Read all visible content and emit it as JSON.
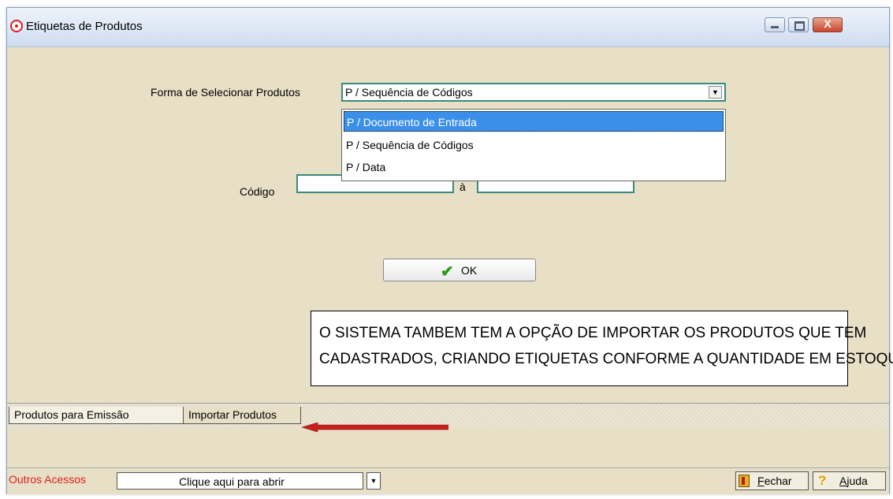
{
  "window": {
    "title": "Etiquetas de Produtos",
    "close_symbol": "X"
  },
  "form": {
    "select_label": "Forma de Selecionar Produtos",
    "select_value": "P / Sequência de Códigos",
    "options": [
      "P / Documento de Entrada",
      "P / Sequência de Códigos",
      "P / Data"
    ],
    "codigo_label": "Código",
    "range_separator": "à",
    "ok_label": "OK"
  },
  "note": {
    "line1": "O SISTEMA TAMBEM TEM A OPÇÃO DE IMPORTAR OS PRODUTOS QUE TEM",
    "line2": "CADASTRADOS,  CRIANDO ETIQUETAS CONFORME A QUANTIDADE EM ESTOQUE."
  },
  "tabs": [
    "Produtos para Emissão",
    "Importar Produtos"
  ],
  "bottom": {
    "outros_label": "Outros Acessos",
    "open_combo_text": "Clique aqui para abrir",
    "fechar_first": "F",
    "fechar_rest": "echar",
    "ajuda_first": "A",
    "ajuda_rest": "juda"
  },
  "colors": {
    "window_bg": "#e7dfc6",
    "field_border": "#3a8a7e",
    "selected_option": "#3c8fe8",
    "arrow": "#c8201c",
    "outros_label": "#e0201e"
  },
  "icons": [
    "app-icon",
    "minimize-icon",
    "maximize-icon",
    "close-icon",
    "dropdown-arrow-icon",
    "check-icon",
    "red-arrow-icon",
    "door-exit-icon",
    "help-icon"
  ]
}
